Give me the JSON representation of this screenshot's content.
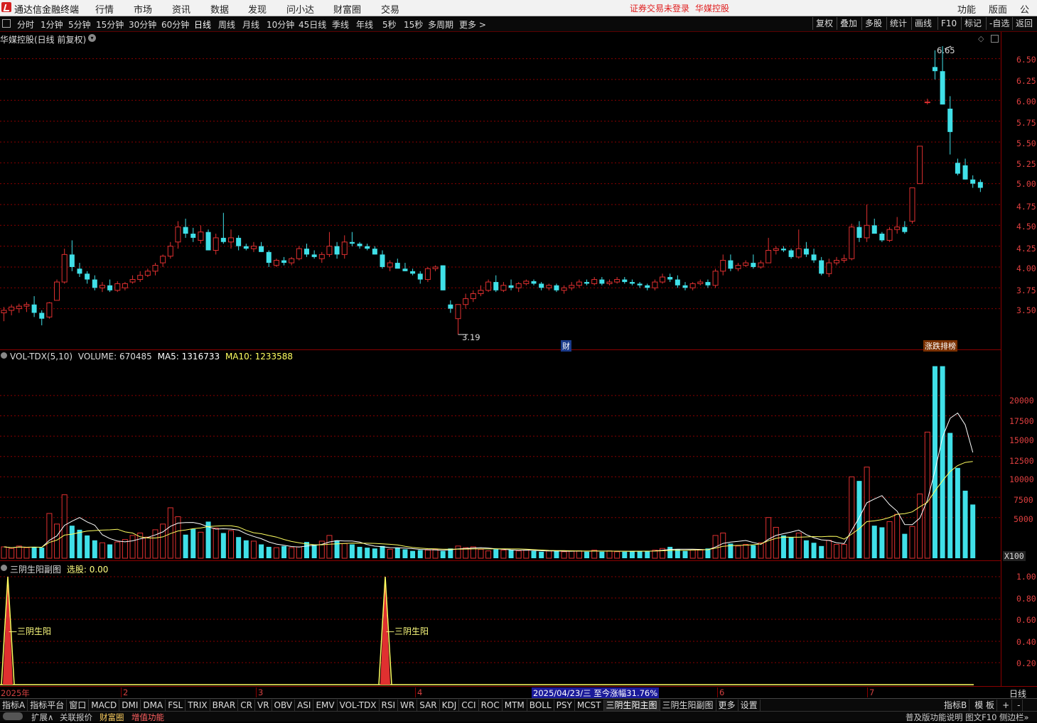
{
  "app": {
    "title": "通达信金融终端",
    "menu": [
      "行情",
      "市场",
      "资讯",
      "数据",
      "发现",
      "问小达",
      "财富圈",
      "交易"
    ],
    "warn_login": "证券交易未登录",
    "warn_stock": "华媒控股",
    "right_menu": [
      "功能",
      "版面",
      "公式"
    ]
  },
  "toolbar": {
    "periods": [
      "分时",
      "1分钟",
      "5分钟",
      "15分钟",
      "30分钟",
      "60分钟",
      "日线",
      "周线",
      "月线",
      "10分钟",
      "45日线",
      "季线",
      "年线",
      "5秒",
      "15秒",
      "多周期",
      "更多 >"
    ],
    "active_period": "日线",
    "right_buttons": [
      "复权",
      "叠加",
      "多股",
      "统计",
      "画线",
      "F10",
      "标记",
      "-自选",
      "返回"
    ]
  },
  "main_panel": {
    "title": "华媒控股(日线 前复权)",
    "high_label": "6.65",
    "low_label": "3.19",
    "marker_cai": "财",
    "marker_board": "涨跌排榜",
    "y_ticks": [
      "6.50",
      "6.25",
      "6.00",
      "5.75",
      "5.50",
      "5.25",
      "5.00",
      "4.75",
      "4.50",
      "4.25",
      "4.00",
      "3.75",
      "3.50"
    ]
  },
  "vol_panel": {
    "title": "VOL-TDX(5,10)",
    "volume_label": "VOLUME: 670485",
    "ma5_label": "MA5: 1316733",
    "ma10_label": "MA10: 1233588",
    "y_ticks": [
      "20000",
      "17500",
      "15000",
      "12500",
      "10000",
      "7500",
      "5000"
    ],
    "unit": "X100"
  },
  "sub_panel": {
    "title": "三阴生阳副图",
    "select_label": "选股: 0.00",
    "signal_label": "三阴生阳",
    "y_ticks": [
      "1.00",
      "0.80",
      "0.60",
      "0.40",
      "0.20"
    ]
  },
  "date_axis": {
    "labels": [
      "2025年",
      "2",
      "3",
      "4",
      "6",
      "7"
    ],
    "highlight": "2025/04/23/三  至今涨幅31.76%",
    "period_label": "日线"
  },
  "tabs": {
    "items": [
      "指标A",
      "指标平台",
      "窗口",
      "MACD",
      "DMI",
      "DMA",
      "FSL",
      "TRIX",
      "BRAR",
      "CR",
      "VR",
      "OBV",
      "ASI",
      "EMV",
      "VOL-TDX",
      "RSI",
      "WR",
      "SAR",
      "KDJ",
      "CCI",
      "ROC",
      "MTM",
      "BOLL",
      "PSY",
      "MCST",
      "三阴生阳主图",
      "三阴生阳副图",
      "更多",
      "设置"
    ],
    "active": "三阴生阳主图",
    "right": [
      "指标B",
      "模 板",
      "+",
      "-"
    ]
  },
  "status": {
    "items": [
      "扩展∧",
      "关联报价",
      "财富圈",
      "增值功能"
    ],
    "right": "普及版功能说明 图文F10 侧边栏»"
  },
  "colors": {
    "up": "#e03030",
    "down": "#40e0e8",
    "grid": "#8a0000",
    "ma5": "#ffffff",
    "ma10": "#ffff60"
  },
  "chart_data": [
    {
      "type": "candlestick",
      "title": "华媒控股(日线 前复权)",
      "ylim": [
        3.19,
        6.65
      ],
      "ohlc": [
        [
          3.45,
          3.52,
          3.35,
          3.48
        ],
        [
          3.48,
          3.55,
          3.42,
          3.52
        ],
        [
          3.5,
          3.56,
          3.45,
          3.53
        ],
        [
          3.53,
          3.58,
          3.46,
          3.55
        ],
        [
          3.55,
          3.65,
          3.4,
          3.45
        ],
        [
          3.45,
          3.48,
          3.3,
          3.38
        ],
        [
          3.4,
          3.58,
          3.38,
          3.57
        ],
        [
          3.6,
          3.85,
          3.6,
          3.82
        ],
        [
          3.82,
          4.22,
          3.8,
          4.15
        ],
        [
          4.15,
          4.32,
          3.95,
          4.0
        ],
        [
          3.98,
          4.05,
          3.88,
          3.92
        ],
        [
          3.92,
          3.95,
          3.8,
          3.85
        ],
        [
          3.85,
          3.9,
          3.72,
          3.75
        ],
        [
          3.75,
          3.82,
          3.7,
          3.78
        ],
        [
          3.78,
          3.85,
          3.7,
          3.72
        ],
        [
          3.72,
          3.83,
          3.7,
          3.8
        ],
        [
          3.75,
          3.82,
          3.72,
          3.8
        ],
        [
          3.82,
          3.9,
          3.8,
          3.85
        ],
        [
          3.85,
          3.95,
          3.82,
          3.9
        ],
        [
          3.9,
          3.98,
          3.88,
          3.95
        ],
        [
          3.95,
          4.05,
          3.9,
          4.02
        ],
        [
          4.05,
          4.15,
          4.0,
          4.13
        ],
        [
          4.13,
          4.3,
          4.1,
          4.25
        ],
        [
          4.3,
          4.55,
          4.22,
          4.48
        ],
        [
          4.48,
          4.58,
          4.35,
          4.4
        ],
        [
          4.4,
          4.47,
          4.3,
          4.35
        ],
        [
          4.32,
          4.5,
          4.28,
          4.42
        ],
        [
          4.42,
          4.45,
          4.2,
          4.2
        ],
        [
          4.2,
          4.4,
          4.15,
          4.35
        ],
        [
          4.35,
          4.65,
          4.28,
          4.3
        ],
        [
          4.3,
          4.45,
          4.22,
          4.35
        ],
        [
          4.35,
          4.38,
          4.2,
          4.25
        ],
        [
          4.25,
          4.28,
          4.2,
          4.22
        ],
        [
          4.22,
          4.3,
          4.18,
          4.25
        ],
        [
          4.25,
          4.3,
          4.18,
          4.18
        ],
        [
          4.18,
          4.2,
          4.0,
          4.05
        ],
        [
          4.02,
          4.1,
          4.0,
          4.08
        ],
        [
          4.08,
          4.12,
          4.02,
          4.05
        ],
        [
          4.05,
          4.12,
          4.02,
          4.1
        ],
        [
          4.1,
          4.25,
          4.08,
          4.22
        ],
        [
          4.22,
          4.28,
          4.12,
          4.15
        ],
        [
          4.15,
          4.2,
          4.1,
          4.12
        ],
        [
          4.1,
          4.18,
          4.05,
          4.15
        ],
        [
          4.15,
          4.42,
          4.12,
          4.25
        ],
        [
          4.25,
          4.3,
          4.1,
          4.15
        ],
        [
          4.15,
          4.38,
          4.1,
          4.3
        ],
        [
          4.3,
          4.42,
          4.25,
          4.28
        ],
        [
          4.28,
          4.3,
          4.22,
          4.25
        ],
        [
          4.25,
          4.28,
          4.2,
          4.22
        ],
        [
          4.22,
          4.25,
          4.15,
          4.15
        ],
        [
          4.15,
          4.2,
          3.98,
          4.0
        ],
        [
          4.0,
          4.08,
          3.95,
          4.05
        ],
        [
          4.05,
          4.1,
          4.0,
          3.98
        ],
        [
          3.98,
          4.05,
          3.95,
          3.95
        ],
        [
          3.95,
          3.98,
          3.9,
          3.92
        ],
        [
          3.92,
          3.95,
          3.8,
          3.85
        ],
        [
          3.85,
          4.0,
          3.82,
          3.98
        ],
        [
          3.98,
          4.02,
          3.95,
          4.0
        ],
        [
          4.02,
          4.02,
          3.72,
          3.72
        ],
        [
          3.55,
          3.6,
          3.45,
          3.5
        ],
        [
          3.38,
          3.48,
          3.19,
          3.55
        ],
        [
          3.55,
          3.68,
          3.5,
          3.62
        ],
        [
          3.62,
          3.72,
          3.58,
          3.68
        ],
        [
          3.68,
          3.78,
          3.65,
          3.72
        ],
        [
          3.72,
          3.85,
          3.7,
          3.82
        ],
        [
          3.82,
          3.9,
          3.7,
          3.72
        ],
        [
          3.72,
          3.82,
          3.7,
          3.78
        ],
        [
          3.78,
          3.85,
          3.72,
          3.75
        ],
        [
          3.75,
          3.82,
          3.7,
          3.8
        ],
        [
          3.8,
          3.85,
          3.78,
          3.83
        ],
        [
          3.83,
          3.85,
          3.78,
          3.8
        ],
        [
          3.8,
          3.82,
          3.72,
          3.75
        ],
        [
          3.75,
          3.8,
          3.72,
          3.78
        ],
        [
          3.78,
          3.8,
          3.7,
          3.72
        ],
        [
          3.72,
          3.78,
          3.68,
          3.75
        ],
        [
          3.75,
          3.82,
          3.72,
          3.78
        ],
        [
          3.78,
          3.85,
          3.75,
          3.82
        ],
        [
          3.82,
          3.85,
          3.78,
          3.8
        ],
        [
          3.8,
          3.88,
          3.78,
          3.85
        ],
        [
          3.85,
          3.88,
          3.78,
          3.8
        ],
        [
          3.8,
          3.85,
          3.78,
          3.82
        ],
        [
          3.82,
          3.88,
          3.8,
          3.85
        ],
        [
          3.85,
          3.88,
          3.8,
          3.82
        ],
        [
          3.82,
          3.85,
          3.78,
          3.8
        ],
        [
          3.8,
          3.82,
          3.75,
          3.78
        ],
        [
          3.78,
          3.8,
          3.72,
          3.75
        ],
        [
          3.75,
          3.85,
          3.72,
          3.82
        ],
        [
          3.82,
          3.92,
          3.8,
          3.88
        ],
        [
          3.88,
          3.92,
          3.82,
          3.85
        ],
        [
          3.85,
          3.9,
          3.75,
          3.78
        ],
        [
          3.78,
          3.82,
          3.72,
          3.75
        ],
        [
          3.75,
          3.82,
          3.72,
          3.8
        ],
        [
          3.8,
          3.85,
          3.78,
          3.82
        ],
        [
          3.82,
          3.85,
          3.75,
          3.78
        ],
        [
          3.78,
          3.98,
          3.75,
          3.95
        ],
        [
          3.95,
          4.15,
          3.9,
          4.08
        ],
        [
          4.08,
          4.15,
          3.95,
          3.98
        ],
        [
          3.98,
          4.05,
          3.95,
          4.02
        ],
        [
          4.02,
          4.08,
          4.0,
          4.05
        ],
        [
          4.05,
          4.15,
          3.98,
          4.0
        ],
        [
          4.0,
          4.08,
          3.98,
          4.05
        ],
        [
          4.05,
          4.35,
          4.05,
          4.2
        ],
        [
          4.2,
          4.25,
          4.15,
          4.22
        ],
        [
          4.22,
          4.25,
          4.18,
          4.2
        ],
        [
          4.2,
          4.22,
          4.1,
          4.12
        ],
        [
          4.12,
          4.45,
          4.1,
          4.22
        ],
        [
          4.22,
          4.3,
          4.12,
          4.15
        ],
        [
          4.15,
          4.22,
          4.05,
          4.08
        ],
        [
          4.08,
          4.12,
          3.9,
          3.92
        ],
        [
          3.92,
          4.1,
          3.88,
          4.05
        ],
        [
          4.05,
          4.12,
          4.02,
          4.08
        ],
        [
          4.08,
          4.15,
          4.05,
          4.1
        ],
        [
          4.1,
          4.52,
          4.08,
          4.48
        ],
        [
          4.48,
          4.55,
          4.3,
          4.35
        ],
        [
          4.35,
          4.75,
          4.3,
          4.5
        ],
        [
          4.5,
          4.58,
          4.4,
          4.4
        ],
        [
          4.4,
          4.42,
          4.3,
          4.32
        ],
        [
          4.32,
          4.48,
          4.3,
          4.45
        ],
        [
          4.45,
          4.6,
          4.4,
          4.48
        ],
        [
          4.48,
          4.55,
          4.4,
          4.42
        ],
        [
          4.55,
          4.95,
          4.52,
          4.95
        ],
        [
          5.0,
          5.45,
          5.0,
          5.45
        ],
        [
          5.98,
          6.02,
          5.95,
          5.98
        ],
        [
          6.4,
          6.6,
          6.25,
          6.35
        ],
        [
          6.35,
          6.65,
          5.95,
          5.95
        ],
        [
          5.9,
          6.05,
          5.35,
          5.62
        ],
        [
          5.25,
          5.3,
          5.1,
          5.12
        ],
        [
          5.22,
          5.3,
          5.05,
          5.05
        ],
        [
          5.05,
          5.1,
          4.95,
          5.0
        ],
        [
          5.02,
          5.05,
          4.9,
          4.95
        ]
      ],
      "signals": [
        "财",
        "涨跌排榜"
      ]
    },
    {
      "type": "bar",
      "title": "VOL-TDX(5,10)",
      "unit": "X100",
      "ylim": [
        0,
        24000
      ],
      "values": [
        1400,
        1200,
        1500,
        1300,
        1400,
        1300,
        5500,
        4200,
        7800,
        4000,
        3500,
        2800,
        2200,
        1900,
        1700,
        2000,
        2300,
        2800,
        3100,
        2600,
        3500,
        4200,
        6200,
        5100,
        2900,
        3600,
        3200,
        4500,
        3700,
        3100,
        3400,
        2600,
        2200,
        2100,
        1700,
        1400,
        1300,
        1500,
        1300,
        1400,
        2000,
        1700,
        2100,
        2800,
        2200,
        1800,
        1700,
        1400,
        1300,
        1200,
        1500,
        1100,
        1300,
        1100,
        900,
        1000,
        1000,
        1100,
        900,
        1200,
        1500,
        1300,
        1400,
        1100,
        900,
        1100,
        1000,
        1000,
        900,
        1000,
        900,
        800,
        900,
        900,
        800,
        900,
        900,
        800,
        1000,
        800,
        900,
        800,
        800,
        900,
        900,
        900,
        1000,
        1200,
        1400,
        1100,
        900,
        1000,
        1000,
        1200,
        2800,
        3100,
        1800,
        1500,
        1700,
        1600,
        1900,
        5000,
        3800,
        2800,
        2600,
        3100,
        2200,
        1900,
        1500,
        2200,
        1700,
        1700,
        10000,
        9500,
        11200,
        4000,
        3800,
        4500,
        5400,
        3000,
        3900,
        7900,
        15500,
        23600,
        23600,
        15400,
        11100,
        8300,
        6600
      ]
    }
  ]
}
